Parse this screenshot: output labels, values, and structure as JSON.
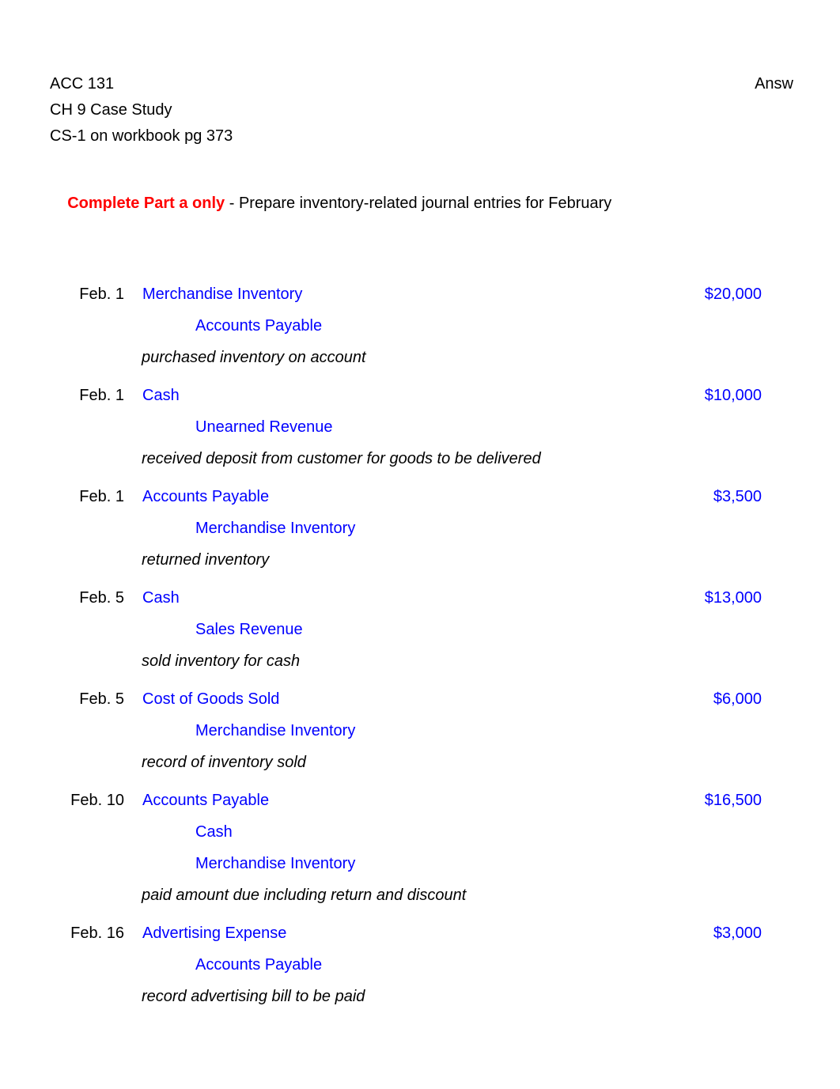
{
  "header": {
    "course": "ACC 131",
    "assignment": "CH 9 Case Study",
    "reference": "CS-1 on workbook pg 373",
    "answer_key_label": "Answ"
  },
  "instruction": {
    "emphasis": "Complete Part a only",
    "remainder": " - Prepare inventory-related journal entries for February"
  },
  "colors": {
    "account_text": "#0000FF",
    "emphasis_text": "#FF0000",
    "body_text": "#000000",
    "page_background": "#ffffff"
  },
  "journal_entries": [
    {
      "date": "Feb. 1",
      "debit_account": "Merchandise Inventory",
      "amount": "$20,000",
      "credit_accounts": [
        "Accounts Payable"
      ],
      "memo": "purchased inventory on account"
    },
    {
      "date": "Feb. 1",
      "debit_account": "Cash",
      "amount": "$10,000",
      "credit_accounts": [
        "Unearned Revenue"
      ],
      "memo": "received deposit from customer for goods to be delivered"
    },
    {
      "date": "Feb. 1",
      "debit_account": "Accounts Payable",
      "amount": "$3,500",
      "credit_accounts": [
        "Merchandise Inventory"
      ],
      "memo": "returned inventory"
    },
    {
      "date": "Feb. 5",
      "debit_account": "Cash",
      "amount": "$13,000",
      "credit_accounts": [
        "Sales Revenue"
      ],
      "memo": "sold inventory for cash"
    },
    {
      "date": "Feb. 5",
      "debit_account": "Cost of Goods Sold",
      "amount": "$6,000",
      "credit_accounts": [
        "Merchandise Inventory"
      ],
      "memo": "record of inventory sold"
    },
    {
      "date": "Feb. 10",
      "debit_account": "Accounts Payable",
      "amount": "$16,500",
      "credit_accounts": [
        "Cash",
        "Merchandise Inventory"
      ],
      "memo": "paid amount due including return and discount"
    },
    {
      "date": "Feb. 16",
      "debit_account": "Advertising Expense",
      "amount": "$3,000",
      "credit_accounts": [
        "Accounts Payable"
      ],
      "memo": "record advertising bill to be paid"
    }
  ]
}
